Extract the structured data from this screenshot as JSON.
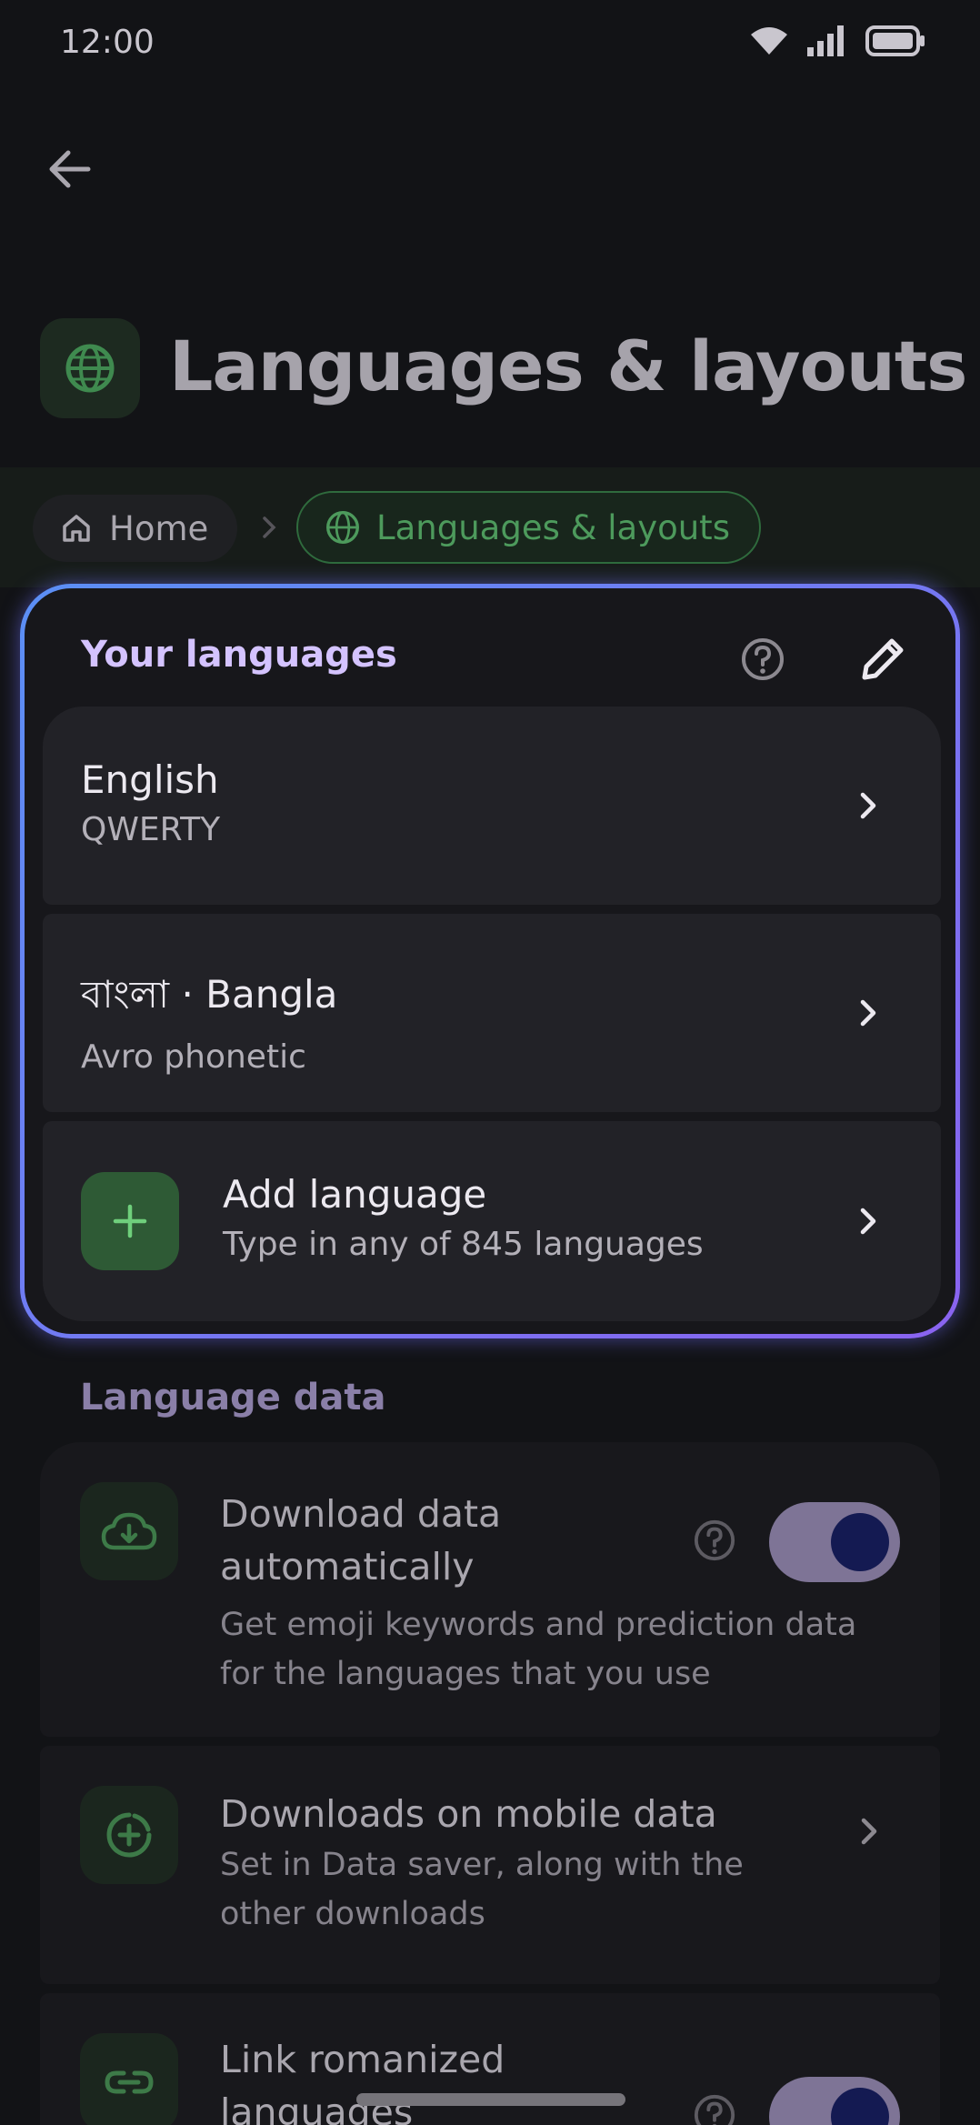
{
  "status_bar": {
    "time": "12:00"
  },
  "header": {
    "title": "Languages & layouts"
  },
  "breadcrumb": {
    "home": "Home",
    "current": "Languages & layouts"
  },
  "your_languages": {
    "title": "Your languages",
    "items": [
      {
        "name": "English",
        "layout": "QWERTY"
      },
      {
        "name": "বাংলা · Bangla",
        "layout": "Avro phonetic"
      }
    ],
    "add": {
      "label": "Add language",
      "description": "Type in any of 845 languages"
    }
  },
  "language_data": {
    "title": "Language data",
    "download_auto": {
      "title_line1": "Download data",
      "title_line2": "automatically",
      "desc_line1": "Get emoji keywords and prediction data",
      "desc_line2": "for the languages that you use",
      "enabled": true
    },
    "mobile_data": {
      "title": "Downloads on mobile data",
      "desc_line1": "Set in Data saver, along with the",
      "desc_line2": "other downloads"
    },
    "link_romanized": {
      "title_line1": "Link romanized",
      "title_line2": "languages",
      "enabled": true
    }
  },
  "colors": {
    "accent_purple": "#d4c3ff",
    "accent_green": "#4d9a5c",
    "card_border_start": "#5b8ff5",
    "card_border_end": "#8a63f0"
  }
}
